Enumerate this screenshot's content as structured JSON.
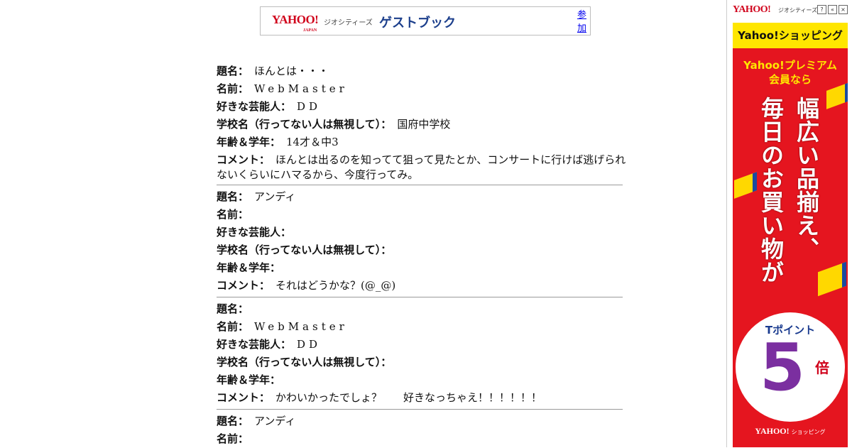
{
  "header": {
    "logo": "YAHOO!",
    "logo_sub": "JAPAN",
    "geocities": "ジオシティーズ",
    "title": "ゲストブック",
    "join_link": "参加"
  },
  "labels": {
    "subject": "題名：",
    "name": "名前：",
    "celebrity": "好きな芸能人：",
    "school": "学校名（行ってない人は無視して）：",
    "age": "年齢＆学年：",
    "comment": "コメント："
  },
  "entries": [
    {
      "subject": "ほんとは・・・",
      "name": "WebMaster",
      "celebrity": "DD",
      "school": "国府中学校",
      "age": "14才＆中3",
      "comment": "ほんとは出るのを知ってて狙って見たとか、コンサートに行けば逃げられないくらいにハマるから、今度行ってみ。"
    },
    {
      "subject": "アンディ",
      "name": "",
      "celebrity": "",
      "school": "",
      "age": "",
      "comment": "それはどうかな？(@_@)"
    },
    {
      "subject": "",
      "name": "WebMaster",
      "celebrity": "DD",
      "school": "",
      "age": "",
      "comment": "かわいかったでしょ？　　好きなっちゃえ！！！！！！"
    },
    {
      "subject": "アンディ",
      "name": ""
    }
  ],
  "ad": {
    "logo": "YAHOO!",
    "logo_sub": "JAPAN",
    "geocities": "ジオシティーズ",
    "buttons": [
      "?",
      "«",
      "×"
    ],
    "shopping_label": "Yahoo!ショッピング",
    "premium_line1": "Yahoo!プレミアム",
    "premium_line2": "会員なら",
    "headline_col1": "幅広い品揃え、",
    "headline_col2": "毎日のお買い物が",
    "tpoint": "Tポイント",
    "multiplier": "5",
    "multiplier_unit": "倍",
    "footer_logo": "YAHOO!",
    "footer_sub": "ショッピング",
    "footer_japan": "JAPAN",
    "colors": {
      "red": "#e5151f",
      "yellow": "#ffe600",
      "navy": "#1a3b8f"
    }
  }
}
